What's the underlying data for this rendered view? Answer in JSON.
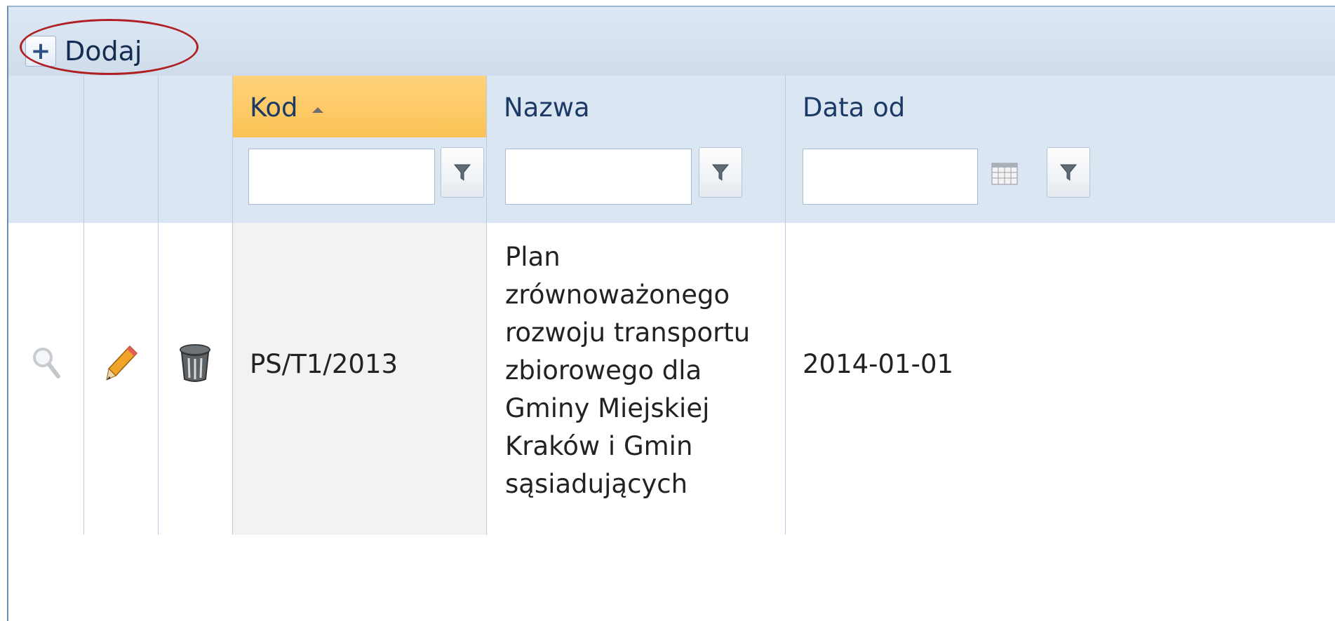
{
  "toolbar": {
    "add_label": "Dodaj",
    "add_icon": "plus-icon"
  },
  "columns": [
    {
      "key": "kod",
      "label": "Kod",
      "sorted": "asc"
    },
    {
      "key": "nazwa",
      "label": "Nazwa"
    },
    {
      "key": "data_od",
      "label": "Data od"
    }
  ],
  "filters": {
    "kod": "",
    "nazwa": "",
    "data_od": ""
  },
  "rows": [
    {
      "kod": "PS/T1/2013",
      "nazwa_lines": [
        "Plan",
        "zrównoważonego",
        "rozwoju transportu",
        "zbiorowego dla",
        "Gminy Miejskiej",
        "Kraków i Gmin",
        "sąsiadujących"
      ],
      "data_od": "2014-01-01",
      "actions": [
        "magnifier-icon",
        "pencil-icon",
        "trash-icon"
      ]
    }
  ],
  "colors": {
    "header_bg": "#dbe6f3",
    "sorted_header": "#fbc356",
    "highlight": "#b01f23",
    "sorted_cell_bg": "#f2f2f2"
  }
}
